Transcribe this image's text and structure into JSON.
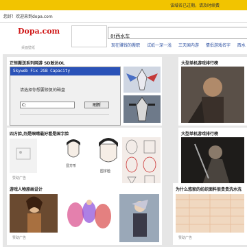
{
  "topbar": {
    "notice": "该域名已过期，请及时续费"
  },
  "welcome": {
    "text": "您好！欢迎来到dopa.com"
  },
  "header": {
    "logo": "Dopa.com",
    "logo_sub": "桌面壁纸",
    "search_value": "8t西水车",
    "hot_links": [
      "现在赚钱的搬职",
      "试纸一深一浅",
      "三天国内游",
      "情侣游戏名字",
      "西水"
    ]
  },
  "panels": {
    "p1": {
      "title": "正恒搬送系列网游 SD敢达OL",
      "dialog_title": "Skyweb Fix 2GB Capacity",
      "dialog_prompt": "请选择你想要修复的磁盘",
      "drive_value": "C:",
      "refresh_label": "刷新"
    },
    "p2": {
      "title": "大型单机游戏排行榜"
    },
    "p3": {
      "title": "四方脸,烈是眼睛最好看是国字脸",
      "labels": [
        "显方形",
        "国字脸"
      ],
      "caption": "赞助广告"
    },
    "p4": {
      "title": "大型单机游戏排行榜"
    },
    "p5": {
      "title": "游戏人物原画设计",
      "caption": "赞助广告"
    },
    "p6": {
      "title": "为什么悠家的纺织面料很贵贵洗水洗",
      "caption": "赞助广告"
    }
  },
  "colors": {
    "topbar": "#f2c400",
    "logo": "#d01a1a",
    "link": "#2a4ea0",
    "content_bg": "#e6e6e6"
  }
}
